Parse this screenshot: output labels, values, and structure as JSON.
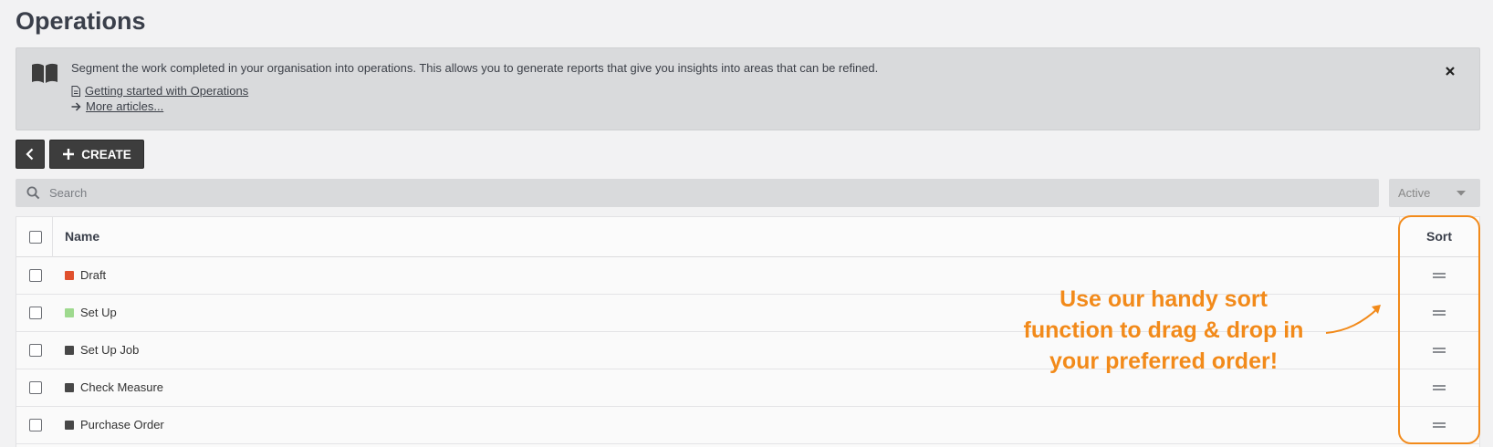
{
  "page": {
    "title": "Operations"
  },
  "info": {
    "description": "Segment the work completed in your organisation into operations. This allows you to generate reports that give you insights into areas that can be refined.",
    "links": [
      {
        "label": "Getting started with Operations",
        "icon": "document-icon"
      },
      {
        "label": "More articles...",
        "icon": "arrow-right-icon"
      }
    ],
    "close_icon": "close-icon"
  },
  "toolbar": {
    "back_icon": "chevron-left-icon",
    "create_label": "CREATE",
    "create_icon": "plus-icon"
  },
  "search": {
    "placeholder": "Search",
    "value": ""
  },
  "filter": {
    "selected": "Active"
  },
  "table": {
    "columns": {
      "name": "Name",
      "sort": "Sort"
    },
    "rows": [
      {
        "name": "Draft",
        "color": "#e0502d"
      },
      {
        "name": "Set Up",
        "color": "#9ed98e"
      },
      {
        "name": "Set Up Job",
        "color": "#474747"
      },
      {
        "name": "Check Measure",
        "color": "#474747"
      },
      {
        "name": "Purchase Order",
        "color": "#474747"
      }
    ]
  },
  "annotation": {
    "lines": [
      "Use our handy sort",
      "function to drag & drop in",
      "your preferred order!"
    ],
    "color": "#f28a1a"
  }
}
